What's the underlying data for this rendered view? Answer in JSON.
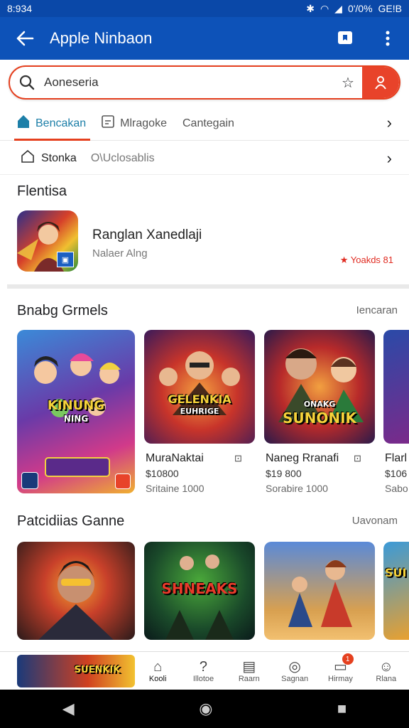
{
  "status": {
    "time": "8:934",
    "battery": "0'/0%",
    "carrier": "GE!B"
  },
  "appbar": {
    "title": "Apple Ninbaon"
  },
  "search": {
    "value": "Aoneseria"
  },
  "tabs": [
    {
      "label": "Bencakan"
    },
    {
      "label": "Mlragoke"
    },
    {
      "label": "Cantegain"
    }
  ],
  "filter": {
    "primary": "Stonka",
    "secondary": "O\\Uclosablis"
  },
  "featured": {
    "heading": "Flentisa",
    "name": "Ranglan Xanedlaji",
    "subtitle": "Nalaer Alng",
    "rating": "Yoakds 81"
  },
  "section1": {
    "heading": "Bnabg Grmels",
    "see_all": "Iencaran",
    "tiles": [
      {
        "title": "",
        "art": "KINUNG",
        "art_sub": "NING"
      },
      {
        "title": "MuraNaktai",
        "price": "$10800",
        "downloads": "Sritaine 1000",
        "art": "GELENKIA",
        "art_sub": "EUHRIGE"
      },
      {
        "title": "Naneg Rranafi",
        "price": "$19 800",
        "downloads": "Sorabire 1000",
        "art": "SUNONIK",
        "art_sub": "ONAKG"
      },
      {
        "title": "Flarl",
        "price": "$106",
        "downloads": "Sabo"
      }
    ]
  },
  "section2": {
    "heading": "Patcidiias Ganne",
    "see_all": "Uavonam",
    "tiles": [
      {
        "art": ""
      },
      {
        "art": "SHNEAKS"
      },
      {
        "art": ""
      },
      {
        "art": "SUI"
      }
    ]
  },
  "bottomnav": {
    "thumb_text": "SUENKIK",
    "items": [
      {
        "label": "Kooli",
        "icon": "home-icon"
      },
      {
        "label": "Illotoe",
        "icon": "question-icon"
      },
      {
        "label": "Raarn",
        "icon": "news-icon"
      },
      {
        "label": "Sagnan",
        "icon": "compass-icon"
      },
      {
        "label": "Hirmay",
        "icon": "inbox-icon",
        "badge": "1"
      },
      {
        "label": "Rlana",
        "icon": "person-icon"
      }
    ]
  },
  "colors": {
    "appbar": "#0d52b8",
    "accent": "#e5401f",
    "tab_active": "#1d7fa8"
  }
}
